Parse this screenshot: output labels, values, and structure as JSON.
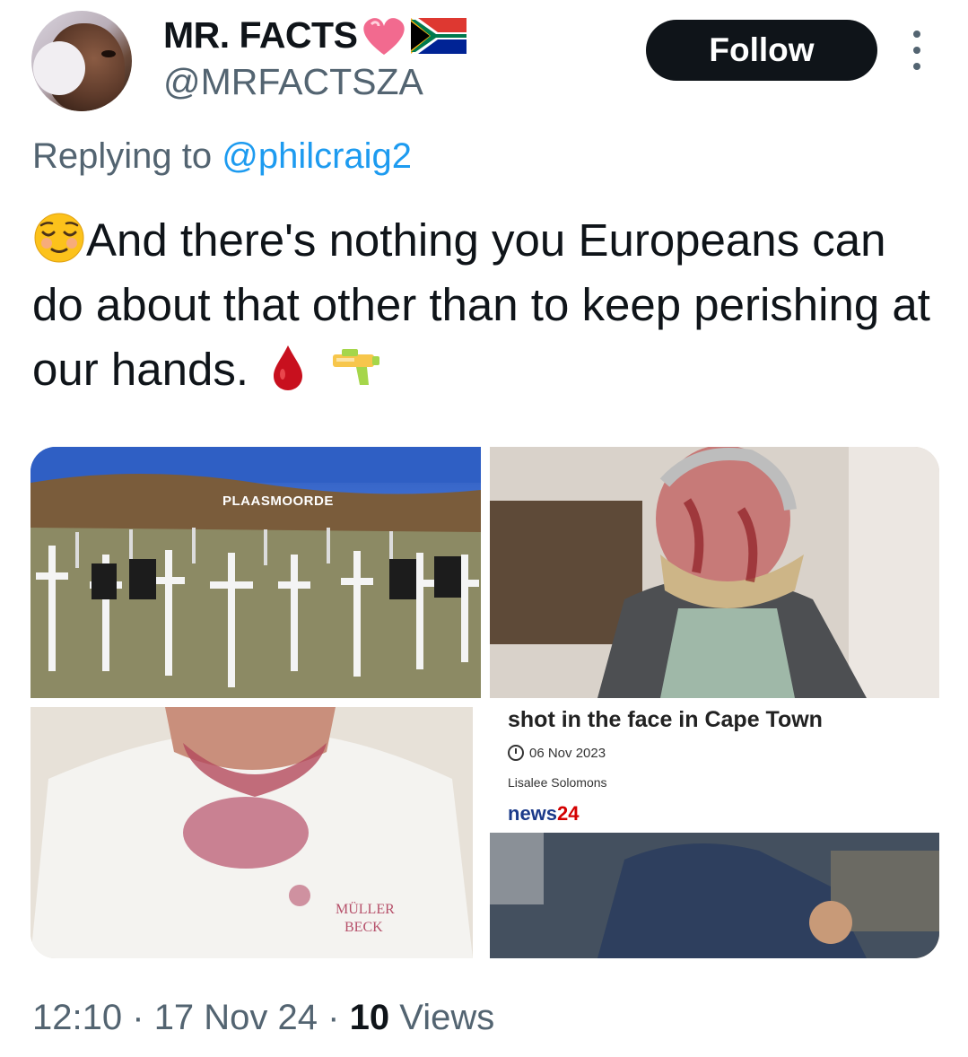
{
  "author": {
    "name": "MR. FACTS",
    "handle": "@MRFACTSZA"
  },
  "follow_label": "Follow",
  "reply": {
    "prefix": "Replying to ",
    "mention": "@philcraig2"
  },
  "tweet": {
    "text": "And there's nothing you Europeans can do about that other than to keep perishing at our hands."
  },
  "media": {
    "news_card": {
      "headline": "shot in the face in Cape Town",
      "date": "06 Nov 2023",
      "author": "Lisalee Solomons",
      "logo_text": "news",
      "logo_number": "24"
    },
    "sign_text": "PLAASMOORDE"
  },
  "meta": {
    "time": "12:10",
    "separator": "·",
    "date": "17 Nov 24",
    "views_count": "10",
    "views_label": "Views"
  }
}
